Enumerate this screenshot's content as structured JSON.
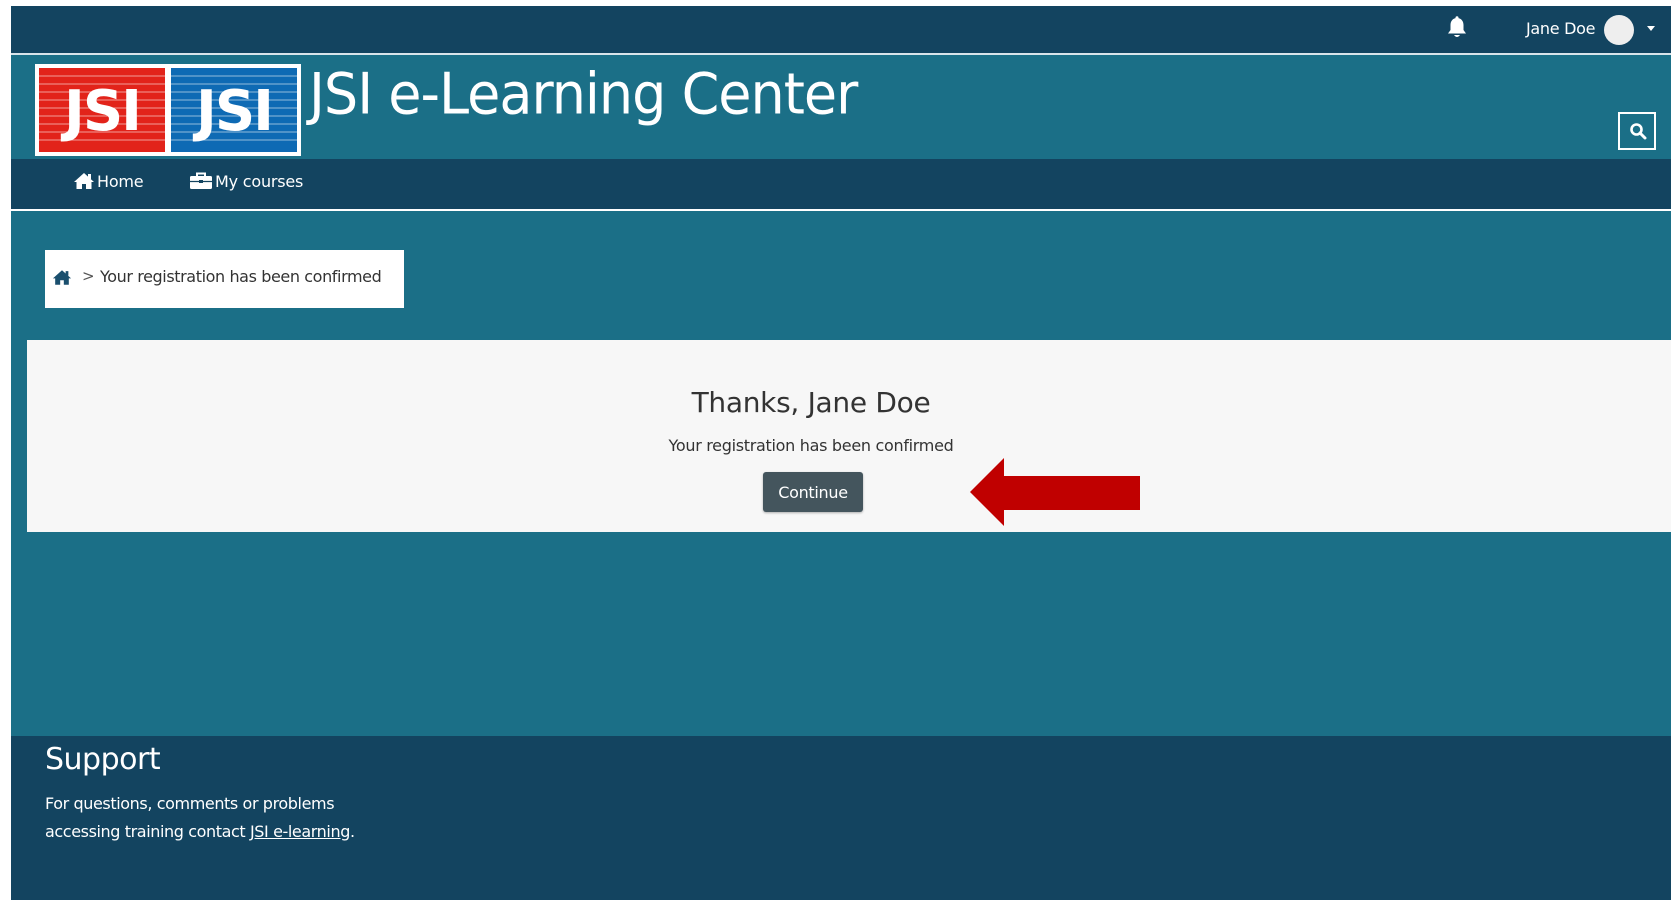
{
  "topbar": {
    "user_name": "Jane Doe",
    "bell_icon": "bell-icon",
    "avatar_icon": "user-avatar",
    "menu_icon": "caret-down-icon"
  },
  "header": {
    "logo_text_left": "JSI",
    "logo_text_right": "JSI",
    "title": "JSI e-Learning Center",
    "search_icon": "search-icon"
  },
  "nav": {
    "items": [
      {
        "label": "Home",
        "icon": "home-icon"
      },
      {
        "label": "My courses",
        "icon": "briefcase-icon"
      }
    ]
  },
  "breadcrumb": {
    "home_icon": "home-icon",
    "separator": ">",
    "current": "Your registration has been confirmed"
  },
  "main": {
    "heading": "Thanks, Jane Doe",
    "message": "Your registration has been confirmed",
    "continue_label": "Continue",
    "annotation": "arrow-pointing-left"
  },
  "footer": {
    "title": "Support",
    "text_before_link": "For questions, comments or problems accessing training contact ",
    "link_text": "JSI e-learning",
    "text_after_link": "."
  },
  "colors": {
    "primary_teal": "#1b6f87",
    "dark_navy": "#134460",
    "button_gray": "#44555d",
    "arrow_red": "#c00000",
    "logo_red": "#e2231a",
    "logo_blue": "#0e6ab4"
  }
}
